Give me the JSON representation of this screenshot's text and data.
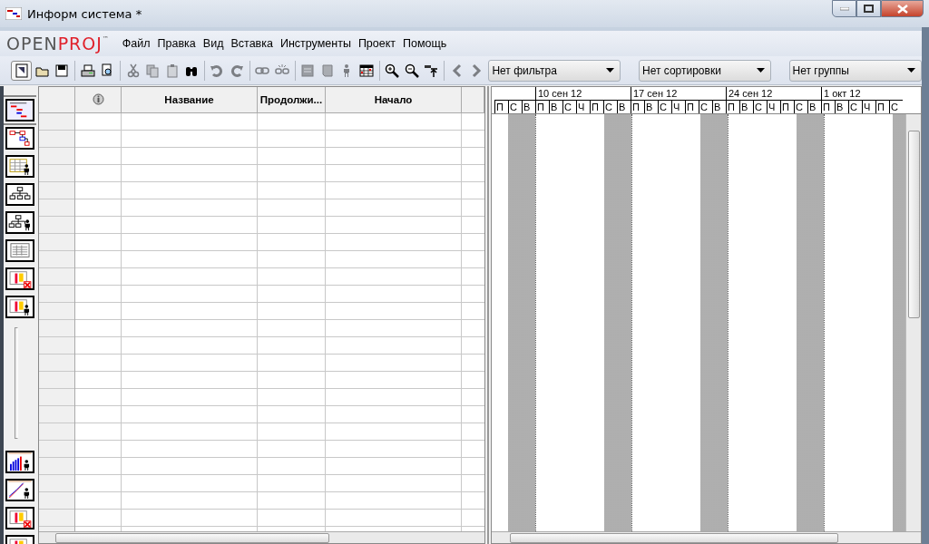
{
  "window": {
    "title": "Информ система *"
  },
  "logo": {
    "first": "OPEN",
    "second": "PROJ",
    "mark": "™"
  },
  "menu": [
    "Файл",
    "Правка",
    "Вид",
    "Вставка",
    "Инструменты",
    "Проект",
    "Помощь"
  ],
  "toolbar": [
    {
      "disabled": false
    },
    {
      "disabled": false
    },
    {
      "disabled": false
    },
    {
      "disabled": false
    },
    {
      "disabled": false
    },
    {
      "disabled": true
    },
    {
      "disabled": true
    },
    {
      "disabled": true
    },
    {
      "disabled": false
    },
    {
      "disabled": true
    },
    {
      "disabled": true
    },
    {
      "disabled": true
    },
    {
      "disabled": true
    },
    {
      "disabled": true
    },
    {
      "disabled": true
    },
    {
      "disabled": true
    },
    {
      "disabled": false
    },
    {
      "disabled": false
    },
    {
      "disabled": false
    },
    {
      "disabled": false
    },
    {
      "disabled": true
    },
    {
      "disabled": true
    }
  ],
  "dropdowns": [
    {
      "value": "Нет фильтра"
    },
    {
      "value": "Нет сортировки"
    },
    {
      "value": "Нет группы"
    }
  ],
  "views": [
    {
      "selected": true
    },
    {
      "selected": false
    },
    {
      "selected": false
    },
    {
      "selected": false
    },
    {
      "selected": false
    },
    {
      "selected": false
    },
    {
      "selected": false
    },
    {
      "selected": false
    },
    {
      "selected": false
    },
    {
      "selected": false
    },
    {
      "selected": false
    },
    {
      "selected": false
    }
  ],
  "table": {
    "columns": [
      "Название",
      "Продолжи...",
      "Начало"
    ]
  },
  "gantt": {
    "lead_days": [
      {
        "label": "П",
        "weekend": false
      },
      {
        "label": "С",
        "weekend": true
      },
      {
        "label": "В",
        "weekend": true
      }
    ],
    "weeks": [
      {
        "label": "10 сен 12",
        "days": [
          {
            "label": "П",
            "weekend": false
          },
          {
            "label": "В",
            "weekend": false
          },
          {
            "label": "С",
            "weekend": false
          },
          {
            "label": "Ч",
            "weekend": false
          },
          {
            "label": "П",
            "weekend": false
          },
          {
            "label": "С",
            "weekend": true
          },
          {
            "label": "В",
            "weekend": true
          }
        ]
      },
      {
        "label": "17 сен 12",
        "days": [
          {
            "label": "П",
            "weekend": false
          },
          {
            "label": "В",
            "weekend": false
          },
          {
            "label": "С",
            "weekend": false
          },
          {
            "label": "Ч",
            "weekend": false
          },
          {
            "label": "П",
            "weekend": false
          },
          {
            "label": "С",
            "weekend": true
          },
          {
            "label": "В",
            "weekend": true
          }
        ]
      },
      {
        "label": "24 сен 12",
        "days": [
          {
            "label": "П",
            "weekend": false
          },
          {
            "label": "В",
            "weekend": false
          },
          {
            "label": "С",
            "weekend": false
          },
          {
            "label": "Ч",
            "weekend": false
          },
          {
            "label": "П",
            "weekend": false
          },
          {
            "label": "С",
            "weekend": true
          },
          {
            "label": "В",
            "weekend": true
          }
        ]
      },
      {
        "label": "1 окт 12",
        "days": [
          {
            "label": "П",
            "weekend": false
          },
          {
            "label": "В",
            "weekend": false
          },
          {
            "label": "С",
            "weekend": false
          },
          {
            "label": "Ч",
            "weekend": false
          },
          {
            "label": "П",
            "weekend": false
          },
          {
            "label": "С",
            "weekend": true
          }
        ]
      }
    ]
  }
}
